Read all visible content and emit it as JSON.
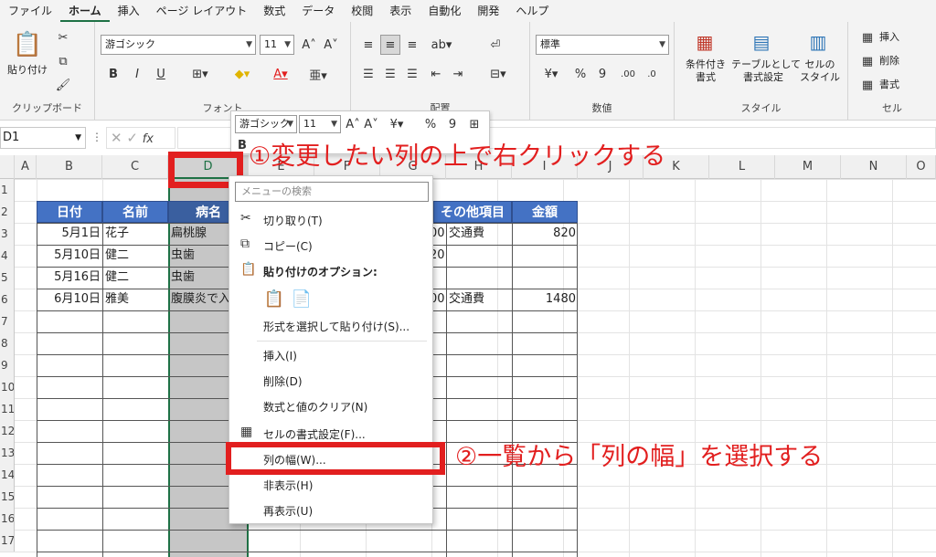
{
  "menu_tabs": [
    "ファイル",
    "ホーム",
    "挿入",
    "ページ レイアウト",
    "数式",
    "データ",
    "校閲",
    "表示",
    "自動化",
    "開発",
    "ヘルプ"
  ],
  "ribbon": {
    "clipboard": {
      "paste": "貼り付け",
      "label": "クリップボード"
    },
    "font": {
      "name": "游ゴシック",
      "size": "11",
      "label": "フォント",
      "bold": "B",
      "italic": "I",
      "underline": "U"
    },
    "alignment": {
      "label": "配置"
    },
    "number": {
      "format": "標準",
      "label": "数値"
    },
    "styles": {
      "conditional": "条件付き\n書式",
      "table": "テーブルとして\n書式設定",
      "cell_style": "セルの\nスタイル",
      "label": "スタイル"
    },
    "cells": {
      "insert": "挿入",
      "delete": "削除",
      "format": "書式",
      "label": "セル"
    }
  },
  "formula_bar": {
    "name_box": "D1",
    "fx": "fx"
  },
  "columns": [
    "A",
    "B",
    "C",
    "D",
    "E",
    "F",
    "G",
    "H",
    "I",
    "J",
    "K",
    "L",
    "M",
    "N",
    "O"
  ],
  "rows": [
    "1",
    "2",
    "3",
    "4",
    "5",
    "6",
    "7",
    "8",
    "9",
    "10",
    "11",
    "12",
    "13",
    "14",
    "15",
    "16",
    "17"
  ],
  "table": {
    "headers": {
      "date": "日付",
      "name": "名前",
      "disease": "病名",
      "other": "その他項目",
      "amount": "金額"
    },
    "rows": [
      {
        "date": "5月1日",
        "name": "花子",
        "disease": "扁桃腺",
        "g": "00",
        "other": "交通費",
        "amount": "820"
      },
      {
        "date": "5月10日",
        "name": "健二",
        "disease": "虫歯",
        "g": "20",
        "other": "",
        "amount": ""
      },
      {
        "date": "5月16日",
        "name": "健二",
        "disease": "虫歯",
        "g": "",
        "other": "",
        "amount": ""
      },
      {
        "date": "6月10日",
        "name": "雅美",
        "disease": "腹膜炎で入",
        "g": "00",
        "other": "交通費",
        "amount": "1480"
      }
    ]
  },
  "mini_toolbar": {
    "font": "游ゴシック",
    "size": "11",
    "percent": "%",
    "bold": "B"
  },
  "context_menu": {
    "search_placeholder": "メニューの検索",
    "cut": "切り取り(T)",
    "copy": "コピー(C)",
    "paste_options": "貼り付けのオプション:",
    "paste_special": "形式を選択して貼り付け(S)...",
    "insert": "挿入(I)",
    "delete": "削除(D)",
    "clear": "数式と値のクリア(N)",
    "format_cells": "セルの書式設定(F)...",
    "column_width": "列の幅(W)...",
    "hide": "非表示(H)",
    "unhide": "再表示(U)"
  },
  "annotations": {
    "step1": "①変更したい列の上で右クリックする",
    "step2": "②一覧から「列の幅」を選択する"
  },
  "colors": {
    "accent": "#1e7145",
    "table_header": "#4472c4",
    "annotation": "#e21f1f",
    "selection": "#c6c6c6"
  }
}
